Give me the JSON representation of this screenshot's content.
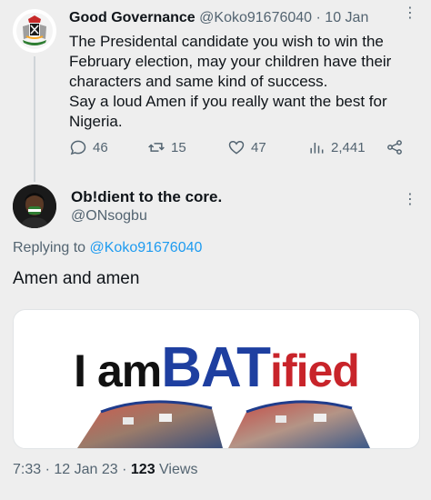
{
  "parent_tweet": {
    "display_name": "Good Governance",
    "handle": "@Koko91676040",
    "separator": "·",
    "date": "10 Jan",
    "more": "⋮",
    "lines": [
      "The Presidental candidate you wish to win the",
      "February election, may your children have their",
      "characters and same kind of success.",
      "Say a loud Amen if you really want the best for",
      "Nigeria."
    ],
    "actions": {
      "replies": "46",
      "retweets": "15",
      "likes": "47",
      "views": "2,441"
    }
  },
  "reply_tweet": {
    "display_name": "Ob!dient to the core.",
    "handle": "@ONsogbu",
    "more": "⋮",
    "replying_prefix": "Replying to",
    "replying_handle": "@Koko91676040",
    "text": "Amen and amen",
    "media": {
      "word_iam": "I am",
      "word_bat": "BAT",
      "word_ified": "ified"
    },
    "time": "7:33",
    "date": "12 Jan 23",
    "views_count": "123",
    "views_label": "Views"
  },
  "colors": {
    "background": "#eeeeee",
    "accent": "#1d9bf0",
    "muted": "#536471",
    "text": "#0f1419",
    "banner_blue": "#1e3fa0",
    "banner_red": "#c8242a"
  }
}
